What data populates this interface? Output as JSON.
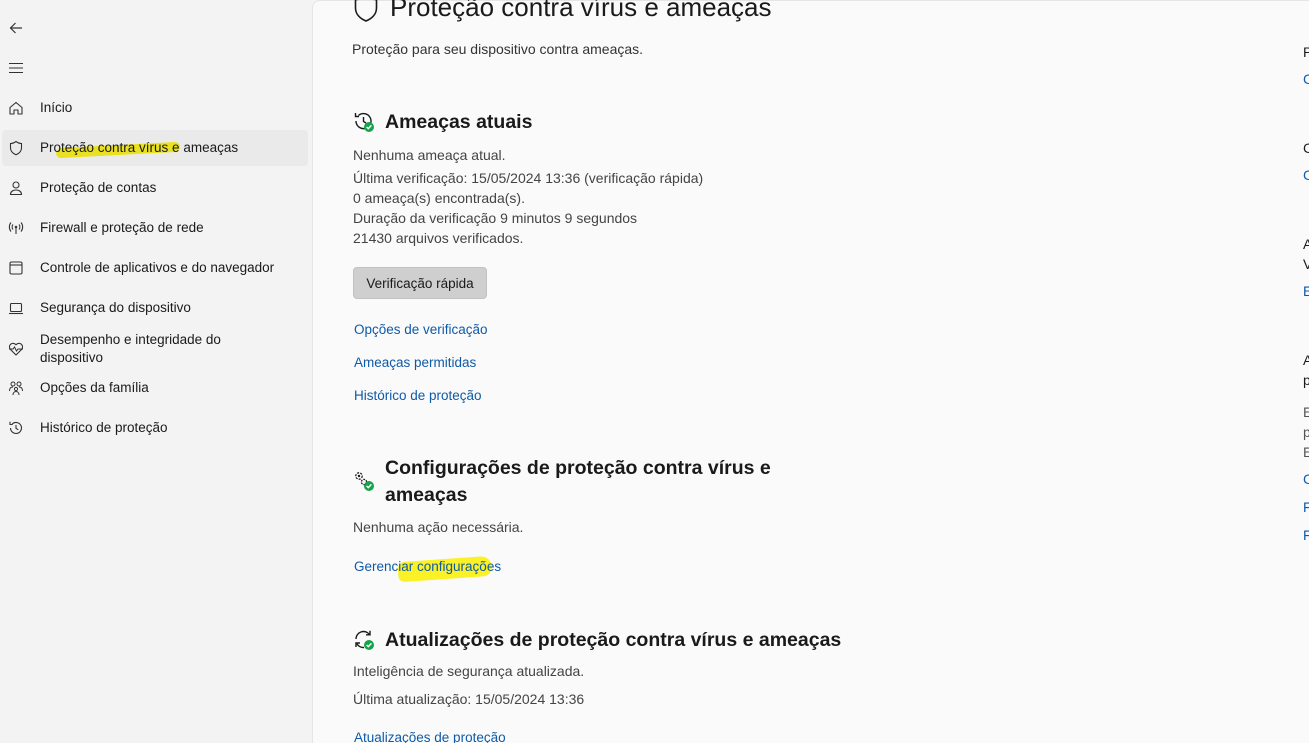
{
  "colors": {
    "link": "#0f5aa8",
    "accent_green": "#16a34a",
    "highlight": "#fff500"
  },
  "nav": {
    "back_icon": "back-arrow-icon",
    "menu_icon": "hamburger-menu-icon",
    "items": [
      {
        "label": "Início",
        "icon": "home-icon"
      },
      {
        "label": "Proteção contra vírus e ameaças",
        "icon": "shield-icon",
        "active": true
      },
      {
        "label": "Proteção de contas",
        "icon": "person-icon"
      },
      {
        "label": "Firewall e proteção de rede",
        "icon": "antenna-icon"
      },
      {
        "label": "Controle de aplicativos e do navegador",
        "icon": "app-window-icon"
      },
      {
        "label": "Segurança do dispositivo",
        "icon": "laptop-icon"
      },
      {
        "label": "Desempenho e integridade do dispositivo",
        "icon": "heart-pulse-icon"
      },
      {
        "label": "Opções da família",
        "icon": "family-icon"
      },
      {
        "label": "Histórico de proteção",
        "icon": "history-icon"
      }
    ]
  },
  "page": {
    "title": "Proteção contra vírus e ameaças",
    "subtitle": "Proteção para seu dispositivo contra ameaças."
  },
  "current_threats": {
    "title": "Ameaças atuais",
    "lines": [
      "Nenhuma ameaça atual.",
      "Última verificação: 15/05/2024 13:36 (verificação rápida)",
      "0 ameaça(s) encontrada(s).",
      "Duração da verificação 9 minutos 9 segundos",
      "21430 arquivos verificados."
    ],
    "quick_scan_button": "Verificação rápida",
    "links": [
      "Opções de verificação",
      "Ameaças permitidas",
      "Histórico de proteção"
    ]
  },
  "settings": {
    "title_line1": "Configurações de proteção contra vírus e",
    "title_line2": "ameaças",
    "status": "Nenhuma ação necessária.",
    "link": "Gerenciar configurações"
  },
  "updates": {
    "title": "Atualizações de proteção contra vírus e ameaças",
    "status": "Inteligência de segurança atualizada.",
    "last_update": "Última atualização: 15/05/2024 13:36",
    "link": "Atualizações de proteção"
  },
  "right_column": [
    "P",
    "C",
    "C",
    "C",
    "A",
    "V",
    "E",
    "A",
    "p",
    "E",
    "p",
    "E",
    "C",
    "F",
    "F"
  ]
}
